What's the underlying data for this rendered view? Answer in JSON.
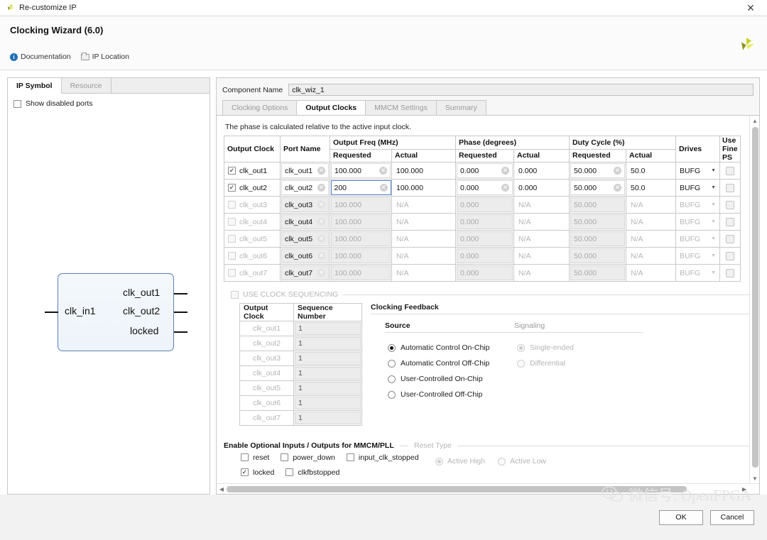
{
  "window": {
    "title": "Re-customize IP",
    "close_icon": "close-icon"
  },
  "header": {
    "title": "Clocking Wizard (6.0)",
    "links": [
      {
        "label": "Documentation",
        "icon": "info-icon"
      },
      {
        "label": "IP Location",
        "icon": "folder-icon"
      }
    ]
  },
  "left_panel": {
    "tabs": [
      {
        "label": "IP Symbol",
        "active": true
      },
      {
        "label": "Resource",
        "active": false
      }
    ],
    "show_disabled_ports": {
      "label": "Show disabled ports",
      "checked": false
    },
    "symbol": {
      "inputs": [
        "clk_in1"
      ],
      "outputs": [
        "clk_out1",
        "clk_out2",
        "locked"
      ]
    }
  },
  "component": {
    "label": "Component Name",
    "value": "clk_wiz_1"
  },
  "tabs": [
    {
      "label": "Clocking Options",
      "active": false
    },
    {
      "label": "Output Clocks",
      "active": true
    },
    {
      "label": "MMCM Settings",
      "active": false
    },
    {
      "label": "Summary",
      "active": false
    }
  ],
  "note": "The phase is calculated relative to the active input clock.",
  "clocks_table": {
    "group_headers": {
      "output_clock": "Output Clock",
      "port_name": "Port Name",
      "output_freq": "Output Freq (MHz)",
      "phase": "Phase (degrees)",
      "duty_cycle": "Duty Cycle (%)",
      "drives": "Drives",
      "use_fine_ps_line1": "Use",
      "use_fine_ps_line2": "Fine PS"
    },
    "sub_headers": {
      "requested": "Requested",
      "actual": "Actual"
    },
    "rows": [
      {
        "name": "clk_out1",
        "enabled": true,
        "port": "clk_out1",
        "freq_req": "100.000",
        "freq_act": "100.000",
        "phase_req": "0.000",
        "phase_act": "0.000",
        "duty_req": "50.000",
        "duty_act": "50.0",
        "drives": "BUFG",
        "use_fine_ps": false,
        "focused": false
      },
      {
        "name": "clk_out2",
        "enabled": true,
        "port": "clk_out2",
        "freq_req": "200",
        "freq_act": "100.000",
        "phase_req": "0.000",
        "phase_act": "0.000",
        "duty_req": "50.000",
        "duty_act": "50.0",
        "drives": "BUFG",
        "use_fine_ps": false,
        "focused": true
      },
      {
        "name": "clk_out3",
        "enabled": false,
        "port": "clk_out3",
        "freq_req": "100.000",
        "freq_act": "N/A",
        "phase_req": "0.000",
        "phase_act": "N/A",
        "duty_req": "50.000",
        "duty_act": "N/A",
        "drives": "BUFG",
        "use_fine_ps": false,
        "focused": false
      },
      {
        "name": "clk_out4",
        "enabled": false,
        "port": "clk_out4",
        "freq_req": "100.000",
        "freq_act": "N/A",
        "phase_req": "0.000",
        "phase_act": "N/A",
        "duty_req": "50.000",
        "duty_act": "N/A",
        "drives": "BUFG",
        "use_fine_ps": false,
        "focused": false
      },
      {
        "name": "clk_out5",
        "enabled": false,
        "port": "clk_out5",
        "freq_req": "100.000",
        "freq_act": "N/A",
        "phase_req": "0.000",
        "phase_act": "N/A",
        "duty_req": "50.000",
        "duty_act": "N/A",
        "drives": "BUFG",
        "use_fine_ps": false,
        "focused": false
      },
      {
        "name": "clk_out6",
        "enabled": false,
        "port": "clk_out6",
        "freq_req": "100.000",
        "freq_act": "N/A",
        "phase_req": "0.000",
        "phase_act": "N/A",
        "duty_req": "50.000",
        "duty_act": "N/A",
        "drives": "BUFG",
        "use_fine_ps": false,
        "focused": false
      },
      {
        "name": "clk_out7",
        "enabled": false,
        "port": "clk_out7",
        "freq_req": "100.000",
        "freq_act": "N/A",
        "phase_req": "0.000",
        "phase_act": "N/A",
        "duty_req": "50.000",
        "duty_act": "N/A",
        "drives": "BUFG",
        "use_fine_ps": false,
        "focused": false
      }
    ]
  },
  "sequencing": {
    "checkbox_label": "USE CLOCK SEQUENCING",
    "checked": false,
    "enabled": false,
    "headers": {
      "output_clock": "Output Clock",
      "sequence_number": "Sequence Number"
    },
    "rows": [
      {
        "name": "clk_out1",
        "seq": "1"
      },
      {
        "name": "clk_out2",
        "seq": "1"
      },
      {
        "name": "clk_out3",
        "seq": "1"
      },
      {
        "name": "clk_out4",
        "seq": "1"
      },
      {
        "name": "clk_out5",
        "seq": "1"
      },
      {
        "name": "clk_out6",
        "seq": "1"
      },
      {
        "name": "clk_out7",
        "seq": "1"
      }
    ]
  },
  "clocking_feedback": {
    "title": "Clocking Feedback",
    "source": {
      "label": "Source",
      "options": [
        {
          "label": "Automatic Control On-Chip",
          "selected": true,
          "disabled": false
        },
        {
          "label": "Automatic Control Off-Chip",
          "selected": false,
          "disabled": false
        },
        {
          "label": "User-Controlled On-Chip",
          "selected": false,
          "disabled": false
        },
        {
          "label": "User-Controlled Off-Chip",
          "selected": false,
          "disabled": false
        }
      ]
    },
    "signaling": {
      "label": "Signaling",
      "options": [
        {
          "label": "Single-ended",
          "selected": true,
          "disabled": true
        },
        {
          "label": "Differential",
          "selected": false,
          "disabled": true
        }
      ]
    }
  },
  "optional": {
    "title": "Enable Optional Inputs / Outputs for MMCM/PLL",
    "row1": [
      {
        "label": "reset",
        "checked": false
      },
      {
        "label": "power_down",
        "checked": false
      },
      {
        "label": "input_clk_stopped",
        "checked": false
      }
    ],
    "row2": [
      {
        "label": "locked",
        "checked": true
      },
      {
        "label": "clkfbstopped",
        "checked": false
      }
    ]
  },
  "reset_type": {
    "title": "Reset Type",
    "options": [
      {
        "label": "Active High",
        "selected": true,
        "disabled": true
      },
      {
        "label": "Active Low",
        "selected": false,
        "disabled": true
      }
    ]
  },
  "footer": {
    "ok": "OK",
    "cancel": "Cancel"
  },
  "watermark": {
    "text": "微信号: OpenFPGA"
  }
}
